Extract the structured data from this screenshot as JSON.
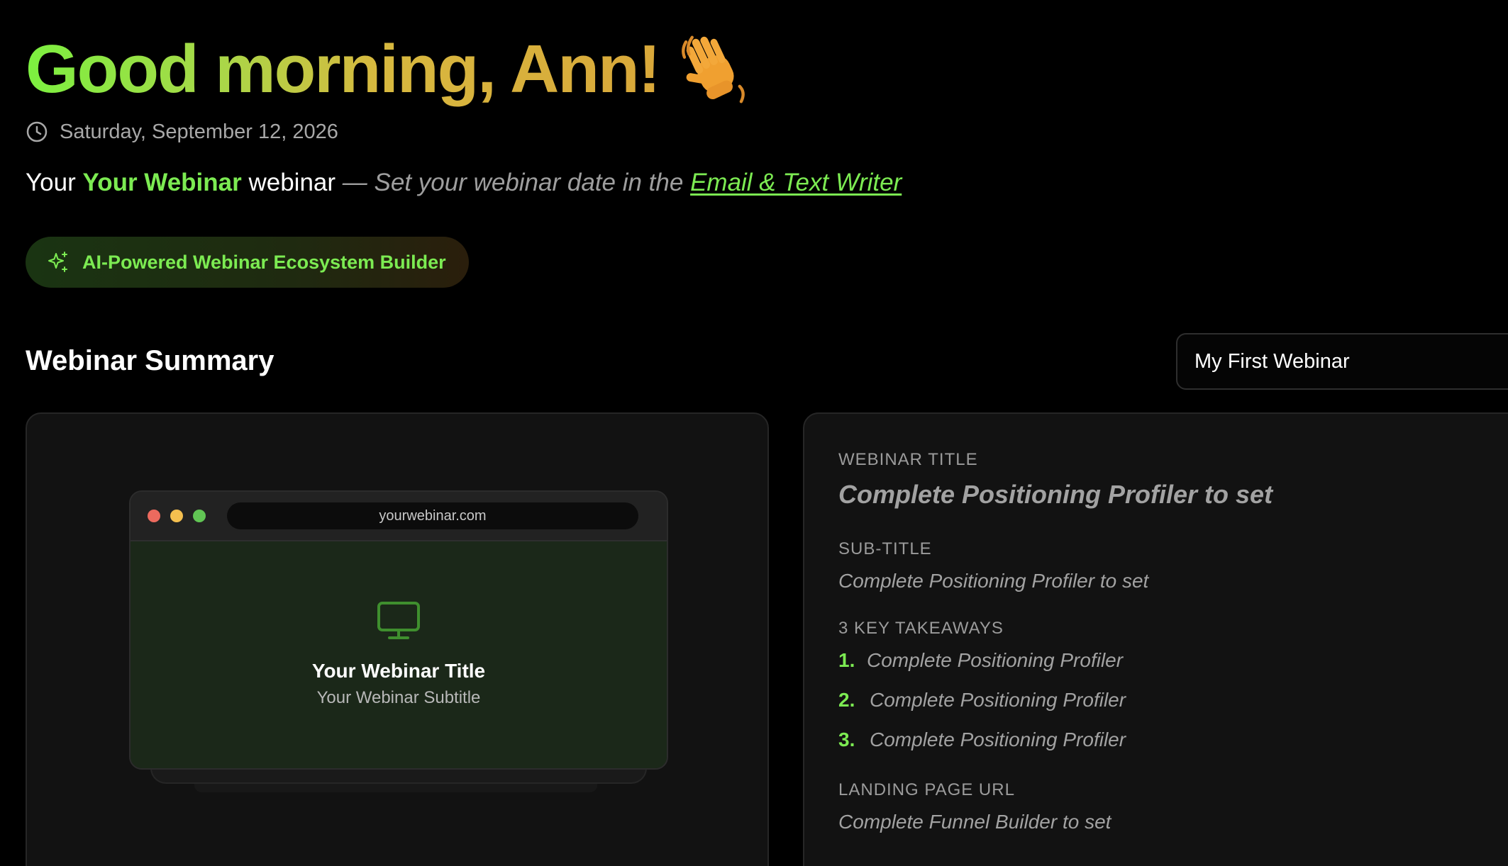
{
  "greeting": {
    "text": "Good morning, Ann!",
    "emoji": "waving-hand"
  },
  "date": "Saturday, September 12, 2026",
  "intro": {
    "prefix": "Your ",
    "webinar_name": "Your Webinar",
    "suffix": " webinar ",
    "hint": "— Set your webinar date in the ",
    "link_text": "Email & Text Writer"
  },
  "ai_badge": {
    "label": "AI-Powered Webinar Ecosystem Builder",
    "icon": "sparkle-icon"
  },
  "summary": {
    "title": "Webinar Summary",
    "selected_webinar": "My First Webinar"
  },
  "preview": {
    "url": "yourwebinar.com",
    "title": "Your Webinar Title",
    "subtitle": "Your Webinar Subtitle"
  },
  "details": {
    "webinar_title_label": "WEBINAR TITLE",
    "webinar_title_value": "Complete Positioning Profiler to set",
    "subtitle_label": "SUB-TITLE",
    "subtitle_value": "Complete Positioning Profiler to set",
    "takeaways_label": "3 KEY TAKEAWAYS",
    "takeaways": [
      {
        "num": "1.",
        "text": "Complete Positioning Profiler"
      },
      {
        "num": "2.",
        "text": "Complete Positioning Profiler"
      },
      {
        "num": "3.",
        "text": "Complete Positioning Profiler"
      }
    ],
    "landing_label": "LANDING PAGE URL",
    "landing_value": "Complete Funnel Builder to set"
  },
  "colors": {
    "accent_green": "#7ceb52",
    "background": "#000000",
    "card": "#121212"
  }
}
